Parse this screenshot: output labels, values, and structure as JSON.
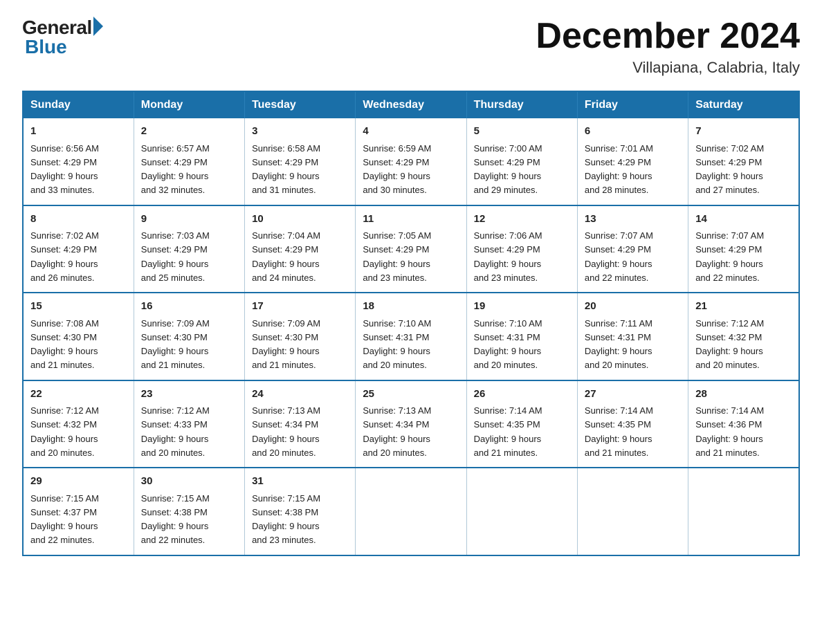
{
  "header": {
    "logo_general": "General",
    "logo_blue": "Blue",
    "month_title": "December 2024",
    "location": "Villapiana, Calabria, Italy"
  },
  "days_of_week": [
    "Sunday",
    "Monday",
    "Tuesday",
    "Wednesday",
    "Thursday",
    "Friday",
    "Saturday"
  ],
  "weeks": [
    [
      {
        "day": "1",
        "sunrise": "6:56 AM",
        "sunset": "4:29 PM",
        "daylight": "9 hours and 33 minutes."
      },
      {
        "day": "2",
        "sunrise": "6:57 AM",
        "sunset": "4:29 PM",
        "daylight": "9 hours and 32 minutes."
      },
      {
        "day": "3",
        "sunrise": "6:58 AM",
        "sunset": "4:29 PM",
        "daylight": "9 hours and 31 minutes."
      },
      {
        "day": "4",
        "sunrise": "6:59 AM",
        "sunset": "4:29 PM",
        "daylight": "9 hours and 30 minutes."
      },
      {
        "day": "5",
        "sunrise": "7:00 AM",
        "sunset": "4:29 PM",
        "daylight": "9 hours and 29 minutes."
      },
      {
        "day": "6",
        "sunrise": "7:01 AM",
        "sunset": "4:29 PM",
        "daylight": "9 hours and 28 minutes."
      },
      {
        "day": "7",
        "sunrise": "7:02 AM",
        "sunset": "4:29 PM",
        "daylight": "9 hours and 27 minutes."
      }
    ],
    [
      {
        "day": "8",
        "sunrise": "7:02 AM",
        "sunset": "4:29 PM",
        "daylight": "9 hours and 26 minutes."
      },
      {
        "day": "9",
        "sunrise": "7:03 AM",
        "sunset": "4:29 PM",
        "daylight": "9 hours and 25 minutes."
      },
      {
        "day": "10",
        "sunrise": "7:04 AM",
        "sunset": "4:29 PM",
        "daylight": "9 hours and 24 minutes."
      },
      {
        "day": "11",
        "sunrise": "7:05 AM",
        "sunset": "4:29 PM",
        "daylight": "9 hours and 23 minutes."
      },
      {
        "day": "12",
        "sunrise": "7:06 AM",
        "sunset": "4:29 PM",
        "daylight": "9 hours and 23 minutes."
      },
      {
        "day": "13",
        "sunrise": "7:07 AM",
        "sunset": "4:29 PM",
        "daylight": "9 hours and 22 minutes."
      },
      {
        "day": "14",
        "sunrise": "7:07 AM",
        "sunset": "4:29 PM",
        "daylight": "9 hours and 22 minutes."
      }
    ],
    [
      {
        "day": "15",
        "sunrise": "7:08 AM",
        "sunset": "4:30 PM",
        "daylight": "9 hours and 21 minutes."
      },
      {
        "day": "16",
        "sunrise": "7:09 AM",
        "sunset": "4:30 PM",
        "daylight": "9 hours and 21 minutes."
      },
      {
        "day": "17",
        "sunrise": "7:09 AM",
        "sunset": "4:30 PM",
        "daylight": "9 hours and 21 minutes."
      },
      {
        "day": "18",
        "sunrise": "7:10 AM",
        "sunset": "4:31 PM",
        "daylight": "9 hours and 20 minutes."
      },
      {
        "day": "19",
        "sunrise": "7:10 AM",
        "sunset": "4:31 PM",
        "daylight": "9 hours and 20 minutes."
      },
      {
        "day": "20",
        "sunrise": "7:11 AM",
        "sunset": "4:31 PM",
        "daylight": "9 hours and 20 minutes."
      },
      {
        "day": "21",
        "sunrise": "7:12 AM",
        "sunset": "4:32 PM",
        "daylight": "9 hours and 20 minutes."
      }
    ],
    [
      {
        "day": "22",
        "sunrise": "7:12 AM",
        "sunset": "4:32 PM",
        "daylight": "9 hours and 20 minutes."
      },
      {
        "day": "23",
        "sunrise": "7:12 AM",
        "sunset": "4:33 PM",
        "daylight": "9 hours and 20 minutes."
      },
      {
        "day": "24",
        "sunrise": "7:13 AM",
        "sunset": "4:34 PM",
        "daylight": "9 hours and 20 minutes."
      },
      {
        "day": "25",
        "sunrise": "7:13 AM",
        "sunset": "4:34 PM",
        "daylight": "9 hours and 20 minutes."
      },
      {
        "day": "26",
        "sunrise": "7:14 AM",
        "sunset": "4:35 PM",
        "daylight": "9 hours and 21 minutes."
      },
      {
        "day": "27",
        "sunrise": "7:14 AM",
        "sunset": "4:35 PM",
        "daylight": "9 hours and 21 minutes."
      },
      {
        "day": "28",
        "sunrise": "7:14 AM",
        "sunset": "4:36 PM",
        "daylight": "9 hours and 21 minutes."
      }
    ],
    [
      {
        "day": "29",
        "sunrise": "7:15 AM",
        "sunset": "4:37 PM",
        "daylight": "9 hours and 22 minutes."
      },
      {
        "day": "30",
        "sunrise": "7:15 AM",
        "sunset": "4:38 PM",
        "daylight": "9 hours and 22 minutes."
      },
      {
        "day": "31",
        "sunrise": "7:15 AM",
        "sunset": "4:38 PM",
        "daylight": "9 hours and 23 minutes."
      },
      null,
      null,
      null,
      null
    ]
  ],
  "labels": {
    "sunrise": "Sunrise:",
    "sunset": "Sunset:",
    "daylight": "Daylight:"
  }
}
